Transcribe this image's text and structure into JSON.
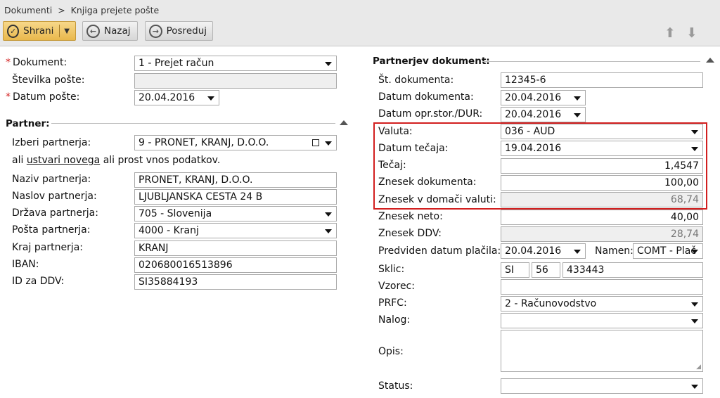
{
  "breadcrumb": [
    "Dokumenti",
    ">",
    "Knjiga prejete pošte"
  ],
  "toolbar": {
    "save": "Shrani",
    "back": "Nazaj",
    "forward": "Posreduj"
  },
  "left": {
    "dokument_label": "Dokument:",
    "dokument_value": "1 - Prejet račun",
    "stevilka_label": "Številka pošte:",
    "stevilka_value": "",
    "datum_label": "Datum pošte:",
    "datum_value": "20.04.2016",
    "partner_section": "Partner:",
    "izberi_label": "Izberi partnerja:",
    "izberi_value": "9 - PRONET, KRANJ, D.O.O.",
    "hint_prefix": "ali",
    "hint_link": "ustvari novega",
    "hint_suffix": "ali prost vnos podatkov.",
    "naziv_label": "Naziv partnerja:",
    "naziv_value": "PRONET, KRANJ, D.O.O.",
    "naslov_label": "Naslov partnerja:",
    "naslov_value": "LJUBLJANSKA CESTA 24 B",
    "drzava_label": "Država partnerja:",
    "drzava_value": "705 - Slovenija",
    "posta_label": "Pošta partnerja:",
    "posta_value": "4000 - Kranj",
    "kraj_label": "Kraj partnerja:",
    "kraj_value": "KRANJ",
    "iban_label": "IBAN:",
    "iban_value": "020680016513896",
    "ddv_label": "ID za DDV:",
    "ddv_value": "SI35884193"
  },
  "right": {
    "section": "Partnerjev dokument:",
    "st_label": "Št. dokumenta:",
    "st_value": "12345-6",
    "datdok_label": "Datum dokumenta:",
    "datdok_value": "20.04.2016",
    "datopr_label": "Datum opr.stor./DUR:",
    "datopr_value": "20.04.2016",
    "valuta_label": "Valuta:",
    "valuta_value": "036 - AUD",
    "dattec_label": "Datum tečaja:",
    "dattec_value": "19.04.2016",
    "tecaj_label": "Tečaj:",
    "tecaj_value": "1,4547",
    "znesek_label": "Znesek dokumenta:",
    "znesek_value": "100,00",
    "domaci_label": "Znesek v domači valuti:",
    "domaci_value": "68,74",
    "neto_label": "Znesek neto:",
    "neto_value": "40,00",
    "zddv_label": "Znesek DDV:",
    "zddv_value": "28,74",
    "predv_label": "Predviden datum plačila:",
    "predv_value": "20.04.2016",
    "namen_label": "Namen:",
    "namen_value": "COMT - Plač",
    "sklic_label": "Sklic:",
    "sklic_1": "SI",
    "sklic_2": "56",
    "sklic_3": "433443",
    "vzorec_label": "Vzorec:",
    "vzorec_value": "",
    "prfc_label": "PRFC:",
    "prfc_value": "2 - Računovodstvo",
    "nalog_label": "Nalog:",
    "nalog_value": "",
    "opis_label": "Opis:",
    "status_label": "Status:",
    "status_value": ""
  },
  "colors": {
    "highlight": "#d21f1f",
    "save_button": "#e9b84c",
    "required": "#d21f1f"
  }
}
